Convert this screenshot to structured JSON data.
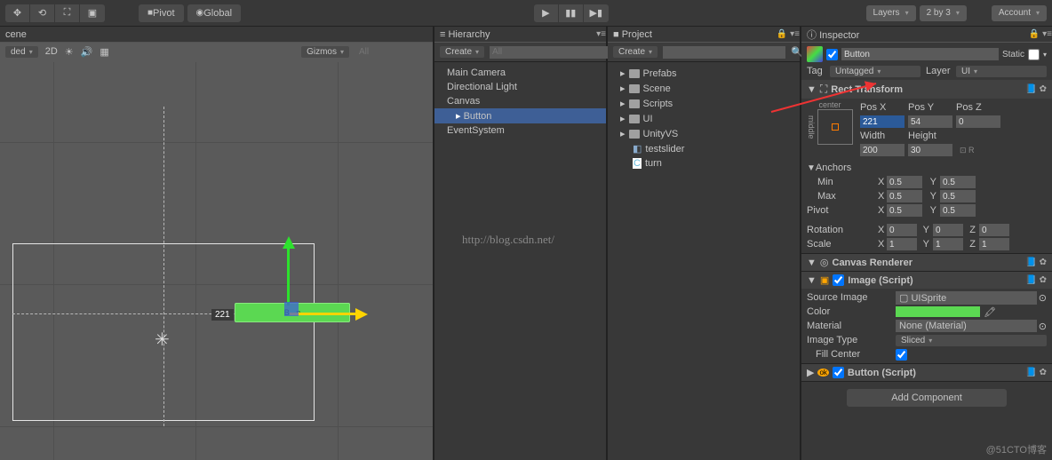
{
  "toolbar": {
    "pivot": "Pivot",
    "global": "Global",
    "layers": "Layers",
    "layout": "2 by 3",
    "account": "Account"
  },
  "scene": {
    "tab": "cene",
    "shaded": "ded",
    "mode2d": "2D",
    "gizmos": "Gizmos",
    "search_ph": "All",
    "distance": "221"
  },
  "hierarchy": {
    "tab": "Hierarchy",
    "create": "Create",
    "search_ph": "All",
    "items": [
      {
        "label": "Main Camera",
        "indent": 0
      },
      {
        "label": "Directional Light",
        "indent": 0
      },
      {
        "label": "Canvas",
        "indent": 0
      },
      {
        "label": "Button",
        "indent": 1,
        "selected": true,
        "arrow": true
      },
      {
        "label": "EventSystem",
        "indent": 0
      }
    ]
  },
  "project": {
    "tab": "Project",
    "create": "Create",
    "items": [
      "Prefabs",
      "Scene",
      "Scripts",
      "UI",
      "UnityVS"
    ],
    "assets": [
      {
        "label": "testslider",
        "icon": "cube"
      },
      {
        "label": "turn",
        "icon": "script"
      }
    ]
  },
  "inspector": {
    "tab": "Inspector",
    "object_name": "Button",
    "static": "Static",
    "tag_label": "Tag",
    "tag_value": "Untagged",
    "layer_label": "Layer",
    "layer_value": "UI",
    "rect": {
      "title": "Rect Transform",
      "anchor_text_h": "center",
      "anchor_text_v": "middle",
      "posx_label": "Pos X",
      "posx": "221",
      "posy_label": "Pos Y",
      "posy": "54",
      "posz_label": "Pos Z",
      "posz": "0",
      "width_label": "Width",
      "width": "200",
      "height_label": "Height",
      "height": "30",
      "anchors": "Anchors",
      "min": "Min",
      "min_x": "0.5",
      "min_y": "0.5",
      "max": "Max",
      "max_x": "0.5",
      "max_y": "0.5",
      "pivot": "Pivot",
      "pivot_x": "0.5",
      "pivot_y": "0.5",
      "rotation": "Rotation",
      "rot_x": "0",
      "rot_y": "0",
      "rot_z": "0",
      "scale": "Scale",
      "sc_x": "1",
      "sc_y": "1",
      "sc_z": "1"
    },
    "canvas_renderer": "Canvas Renderer",
    "image": {
      "title": "Image (Script)",
      "source": "Source Image",
      "source_val": "UISprite",
      "color": "Color",
      "material": "Material",
      "material_val": "None (Material)",
      "imgtype": "Image Type",
      "imgtype_val": "Sliced",
      "fill": "Fill Center"
    },
    "button_script": "Button (Script)",
    "add_component": "Add Component"
  },
  "watermarks": {
    "url": "http://blog.csdn.net/",
    "corner": "@51CTO博客"
  }
}
